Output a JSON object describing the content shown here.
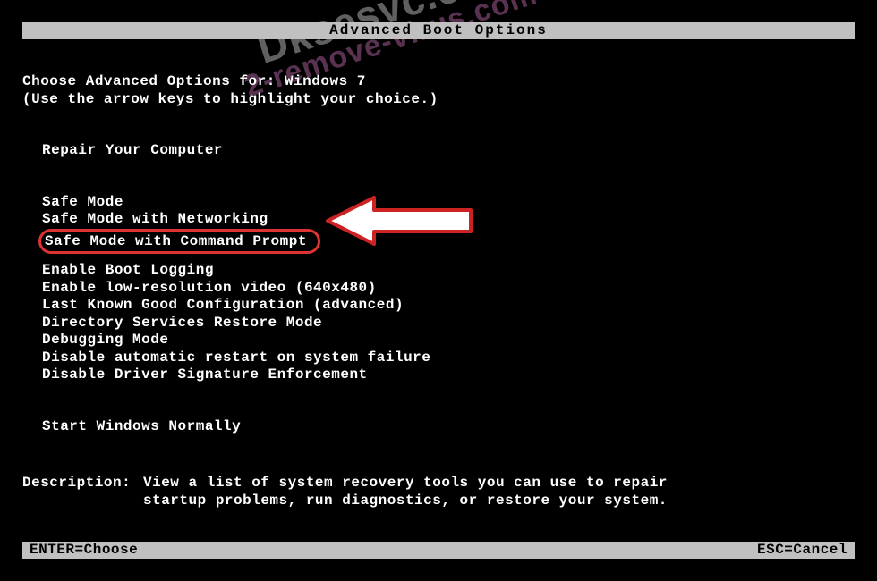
{
  "title": "Advanced Boot Options",
  "choose_label": "Choose Advanced Options for: ",
  "os_name": "Windows 7",
  "hint": "(Use the arrow keys to highlight your choice.)",
  "repair": "Repair Your Computer",
  "opts": {
    "safe": "Safe Mode",
    "safenet": "Safe Mode with Networking",
    "safecmd": "Safe Mode with Command Prompt",
    "bootlog": "Enable Boot Logging",
    "lowres": "Enable low-resolution video (640x480)",
    "lkgc": "Last Known Good Configuration (advanced)",
    "dsrm": "Directory Services Restore Mode",
    "debug": "Debugging Mode",
    "noauto": "Disable automatic restart on system failure",
    "nodrvsig": "Disable Driver Signature Enforcement",
    "normal": "Start Windows Normally"
  },
  "description_label": "Description:",
  "description_line1": "View a list of system recovery tools you can use to repair",
  "description_line2": "startup problems, run diagnostics, or restore your system.",
  "footer_left": "ENTER=Choose",
  "footer_right": "ESC=Cancel",
  "watermark_line1": "Dksesvc.exe",
  "watermark_line2": "2-remove-virus.com"
}
